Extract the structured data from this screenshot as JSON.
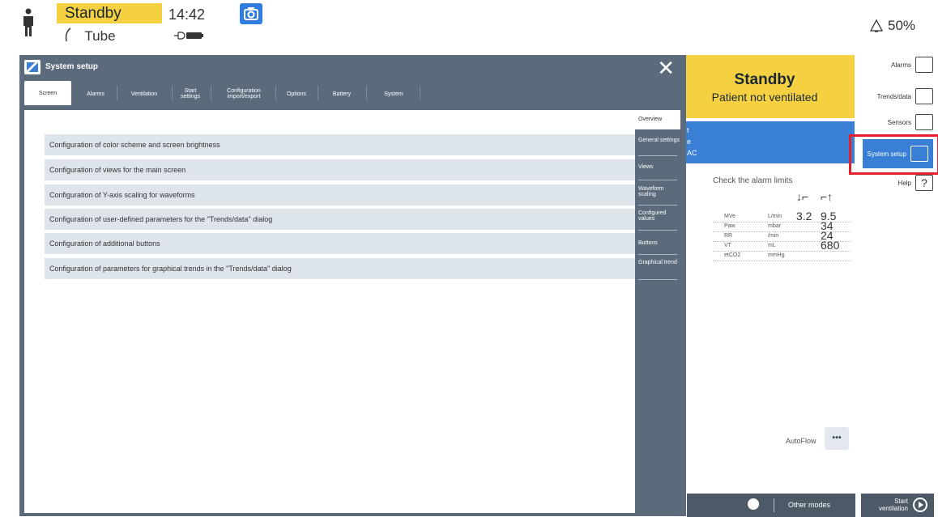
{
  "status_bar": {
    "mode": "Standby",
    "airway": "Tube",
    "time": "14:42",
    "alarm_volume": "50%"
  },
  "status_panel": {
    "title": "Standby",
    "subtitle": "Patient not ventilated",
    "mode_fragments": [
      "t",
      "e",
      "AC"
    ]
  },
  "alarm_check": {
    "header": "Check the alarm limits",
    "low_icon": "↓⌐",
    "high_icon": "⌐↑",
    "rows": [
      {
        "param": "MVe",
        "unit": "L/min",
        "low": "3.2",
        "high": "9.5"
      },
      {
        "param": "Paw",
        "unit": "mbar",
        "low": "",
        "high": "34"
      },
      {
        "param": "RR",
        "unit": "/min",
        "low": "",
        "high": "24"
      },
      {
        "param": "VT",
        "unit": "mL",
        "low": "",
        "high": "680"
      },
      {
        "param": "etCO2",
        "unit": "mmHg",
        "low": "",
        "high": ""
      }
    ]
  },
  "autoflow": {
    "label": "AutoFlow",
    "more": "•••"
  },
  "bottom_bar": {
    "other_modes": "Other modes",
    "start_ventilation": "Start ventilation"
  },
  "side_menu": {
    "alarms": "Alarms",
    "trends": "Trends/data",
    "sensors": "Sensors",
    "system_setup": "System setup",
    "help": "Help"
  },
  "dialog": {
    "title": "System setup",
    "close": "✕",
    "tabs": [
      {
        "label": "Screen",
        "active": true
      },
      {
        "label": "Alarms"
      },
      {
        "label": "Ventilation"
      },
      {
        "label": "Start settings"
      },
      {
        "label": "Configuration import/export"
      },
      {
        "label": "Options"
      },
      {
        "label": "Battery"
      },
      {
        "label": "System"
      }
    ],
    "rows": [
      "Configuration of color scheme and screen brightness",
      "Configuration of views for the main screen",
      "Configuration of Y-axis scaling for waveforms",
      "Configuration of user-defined parameters for the \"Trends/data\" dialog",
      "Configuration of additional buttons",
      "Configuration of parameters for graphical trends in the \"Trends/data\" dialog"
    ],
    "nav": [
      "Overview",
      "General settings",
      "Views",
      "Waveform scaling",
      "Configured values",
      "Buttons",
      "Graphical trend"
    ]
  },
  "colors": {
    "standby_yellow": "#f5d142",
    "accent_blue": "#3a7fd6",
    "dialog_slate": "#5b6b7c",
    "row_bg": "#dde4ec",
    "highlight_red": "#e5202e"
  }
}
